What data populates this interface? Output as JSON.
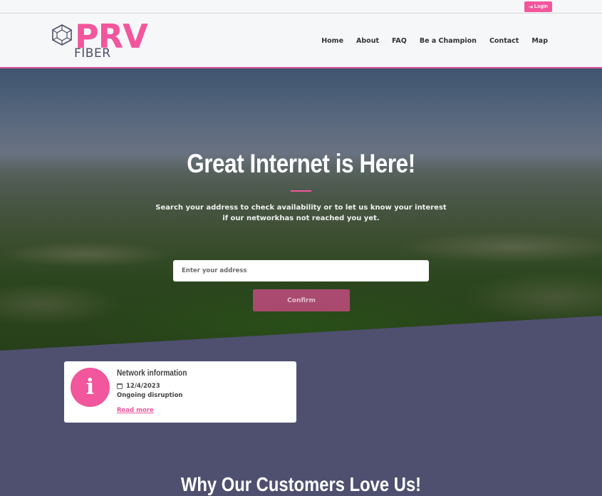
{
  "topbar": {
    "login_label": "Login",
    "login_icon": "sign-in-icon"
  },
  "brand": {
    "name": "PRV",
    "sub": "FIBER",
    "logo_icon": "cube-icon",
    "accent": "#f2569c",
    "dark": "#4f5070"
  },
  "nav": {
    "items": [
      {
        "label": "Home"
      },
      {
        "label": "About"
      },
      {
        "label": "FAQ"
      },
      {
        "label": "Be a Champion"
      },
      {
        "label": "Contact"
      },
      {
        "label": "Map"
      }
    ]
  },
  "hero": {
    "title": "Great Internet is Here!",
    "subtitle_line1": "Search your address to check availability or to let us know your interest",
    "subtitle_line2": "if our networkhas not reached you yet.",
    "input_placeholder": "Enter your address",
    "input_value": "",
    "confirm_label": "Confirm"
  },
  "notice": {
    "icon": "info-icon",
    "title": "Network information",
    "date": "12/4/2023",
    "status": "Ongoing disruption",
    "link_label": "Read more"
  },
  "section": {
    "title": "Why Our Customers Love Us!"
  }
}
